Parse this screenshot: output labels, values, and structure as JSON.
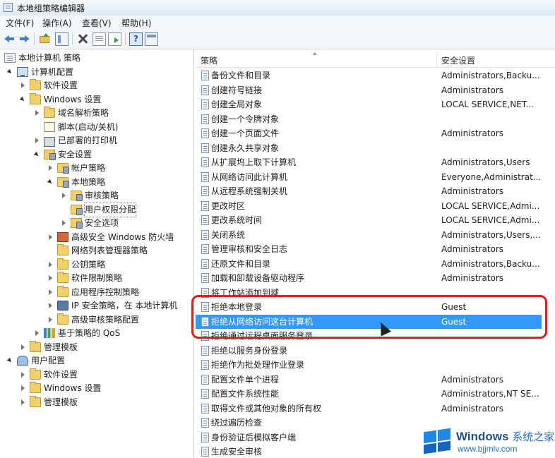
{
  "window": {
    "title": "本地组策略编辑器"
  },
  "menu": [
    "文件(F)",
    "操作(A)",
    "查看(V)",
    "帮助(H)"
  ],
  "toolbar": {
    "icons": [
      "back-arrow-icon",
      "forward-arrow-icon",
      "up-level-icon",
      "show-hide-tree-icon",
      "delete-icon",
      "properties-icon",
      "export-list-icon",
      "help-icon",
      "view-icon"
    ]
  },
  "tree": [
    {
      "label": "本地计算机 策略",
      "level": 0,
      "icon": "policy-icon",
      "expanded": null
    },
    {
      "label": "计算机配置",
      "level": 1,
      "icon": "computer-icon",
      "expanded": true
    },
    {
      "label": "软件设置",
      "level": 2,
      "icon": "folder-icon",
      "expanded": false
    },
    {
      "label": "Windows 设置",
      "level": 2,
      "icon": "folder-icon",
      "expanded": true
    },
    {
      "label": "域名解析策略",
      "level": 3,
      "icon": "folder-icon",
      "expanded": false
    },
    {
      "label": "脚本(启动/关机)",
      "level": 3,
      "icon": "script-icon",
      "expanded": null
    },
    {
      "label": "已部署的打印机",
      "level": 3,
      "icon": "printer-icon",
      "expanded": false
    },
    {
      "label": "安全设置",
      "level": 3,
      "icon": "security-icon",
      "expanded": true
    },
    {
      "label": "帐户策略",
      "level": 4,
      "icon": "security-icon",
      "expanded": false
    },
    {
      "label": "本地策略",
      "level": 4,
      "icon": "security-icon",
      "expanded": true
    },
    {
      "label": "审核策略",
      "level": 5,
      "icon": "security-icon",
      "expanded": false
    },
    {
      "label": "用户权限分配",
      "level": 5,
      "icon": "security-icon",
      "expanded": null,
      "selected": true
    },
    {
      "label": "安全选项",
      "level": 5,
      "icon": "security-icon",
      "expanded": false
    },
    {
      "label": "高级安全 Windows 防火墙",
      "level": 4,
      "icon": "firewall-icon",
      "expanded": false
    },
    {
      "label": "网络列表管理器策略",
      "level": 4,
      "icon": "folder-icon",
      "expanded": null
    },
    {
      "label": "公钥策略",
      "level": 4,
      "icon": "folder-icon",
      "expanded": false
    },
    {
      "label": "软件限制策略",
      "level": 4,
      "icon": "folder-icon",
      "expanded": false
    },
    {
      "label": "应用程序控制策略",
      "level": 4,
      "icon": "folder-icon",
      "expanded": false
    },
    {
      "label": "IP 安全策略，在 本地计算机",
      "level": 4,
      "icon": "ipsec-icon",
      "expanded": false
    },
    {
      "label": "高级审核策略配置",
      "level": 4,
      "icon": "folder-icon",
      "expanded": false
    },
    {
      "label": "基于策略的 QoS",
      "level": 3,
      "icon": "qos-icon",
      "expanded": false
    },
    {
      "label": "管理模板",
      "level": 2,
      "icon": "folder-icon",
      "expanded": false
    },
    {
      "label": "用户配置",
      "level": 1,
      "icon": "user-icon",
      "expanded": true
    },
    {
      "label": "软件设置",
      "level": 2,
      "icon": "folder-icon",
      "expanded": false
    },
    {
      "label": "Windows 设置",
      "level": 2,
      "icon": "folder-icon",
      "expanded": false
    },
    {
      "label": "管理模板",
      "level": 2,
      "icon": "folder-icon",
      "expanded": false
    }
  ],
  "list": {
    "columns": {
      "policy": "策略",
      "security": "安全设置"
    },
    "rows": [
      {
        "policy": "备份文件和目录",
        "security": "Administrators,Backu..."
      },
      {
        "policy": "创建符号链接",
        "security": "Administrators"
      },
      {
        "policy": "创建全局对象",
        "security": "LOCAL SERVICE,NET..."
      },
      {
        "policy": "创建一个令牌对象",
        "security": ""
      },
      {
        "policy": "创建一个页面文件",
        "security": "Administrators"
      },
      {
        "policy": "创建永久共享对象",
        "security": ""
      },
      {
        "policy": "从扩展坞上取下计算机",
        "security": "Administrators,Users"
      },
      {
        "policy": "从网络访问此计算机",
        "security": "Everyone,Administrat..."
      },
      {
        "policy": "从远程系统强制关机",
        "security": "Administrators"
      },
      {
        "policy": "更改时区",
        "security": "LOCAL SERVICE,Admi..."
      },
      {
        "policy": "更改系统时间",
        "security": "LOCAL SERVICE,Admi..."
      },
      {
        "policy": "关闭系统",
        "security": "Administrators,Users,..."
      },
      {
        "policy": "管理审核和安全日志",
        "security": "Administrators"
      },
      {
        "policy": "还原文件和目录",
        "security": "Administrators,Backu..."
      },
      {
        "policy": "加载和卸载设备驱动程序",
        "security": "Administrators"
      },
      {
        "policy": "将工作站添加到域",
        "security": ""
      },
      {
        "policy": "拒绝本地登录",
        "security": "Guest"
      },
      {
        "policy": "拒绝从网络访问这台计算机",
        "security": "Guest",
        "selected": true
      },
      {
        "policy": "拒绝通过远程桌面服务登录",
        "security": ""
      },
      {
        "policy": "拒绝以服务身份登录",
        "security": ""
      },
      {
        "policy": "拒绝作为批处理作业登录",
        "security": ""
      },
      {
        "policy": "配置文件单个进程",
        "security": "Administrators"
      },
      {
        "policy": "配置文件系统性能",
        "security": "Administrators,NT SE..."
      },
      {
        "policy": "取得文件或其他对象的所有权",
        "security": "Administrators"
      },
      {
        "policy": "绕过遍历检查",
        "security": ""
      },
      {
        "policy": "身份验证后模拟客户端",
        "security": ""
      },
      {
        "policy": "生成安全审核",
        "security": ""
      }
    ]
  },
  "colors": {
    "selection": "#3399ff",
    "highlight_box": "#e01e1e"
  },
  "watermark": {
    "brand": "Windows",
    "brand_cn": "系统之家",
    "url": "www.bjjmlv.com"
  }
}
